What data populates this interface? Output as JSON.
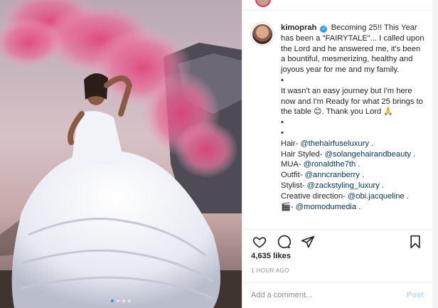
{
  "post": {
    "username": "kimoprah",
    "verified_glyph": "✓",
    "caption": {
      "intro": "Becoming 25!! This Year has been a \"FAIRYTALE\"... I called upon the Lord and he answered me, it's been a bountiful, mesmerizing, healthy and joyous year for me and my family.",
      "dot1": "•",
      "para2": "It wasn't an easy journey but I'm here now and I'm Ready for what 25 brings to the table",
      "emoji_smile": "😊",
      "thanks": ". Thank you Lord",
      "emoji_pray": "🙏",
      "dot2": "•",
      "dot3": "•",
      "credits": [
        {
          "label": "Hair- ",
          "mention": "@thehairfuseluxury",
          "suffix": " ."
        },
        {
          "label": "Hair Styled- ",
          "mention": "@solangehairandbeauty",
          "suffix": " ."
        },
        {
          "label": "MUA- ",
          "mention": "@ronaldthe7th",
          "suffix": " ."
        },
        {
          "label": "Outfit- ",
          "mention": "@anncranberry",
          "suffix": " ."
        },
        {
          "label": "Stylist- ",
          "mention": "@zackstyling_luxury",
          "suffix": " ."
        },
        {
          "label": "Creative direction- ",
          "mention": "@obi.jacqueline",
          "suffix": " ."
        },
        {
          "label": "🎬- ",
          "mention": "@momodumedia",
          "suffix": " ."
        }
      ]
    },
    "likes": "4,635 likes",
    "timestamp": "1 HOUR AGO",
    "comment": {
      "placeholder": "Add a comment...",
      "post_label": "Post"
    },
    "carousel": {
      "count": 4,
      "active_index": 0
    }
  },
  "colors": {
    "accent": "#3897f0",
    "mention": "#00376b",
    "post_disabled": "#b2dffc",
    "muted": "#8e8e8e"
  },
  "icons": [
    "heart-icon",
    "comment-icon",
    "share-icon",
    "bookmark-icon",
    "verified-icon"
  ]
}
